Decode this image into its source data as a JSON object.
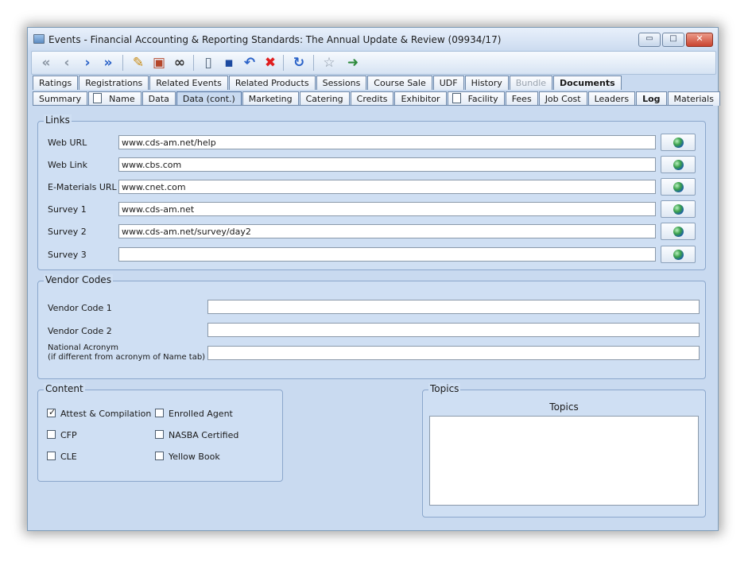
{
  "window": {
    "title": "Events - Financial Accounting & Reporting Standards: The Annual Update & Review (09934/17)",
    "controls": {
      "minimize": "▭",
      "maximize": "□",
      "close": "✕"
    }
  },
  "toolbar": {
    "first": "«",
    "prev": "‹",
    "next": "›",
    "last": "»",
    "notes": "✎",
    "report": "▣",
    "find": "∞",
    "new": "▯",
    "save": "▪",
    "undo": "↶",
    "delete": "✖",
    "refresh": "↻",
    "favorite": "☆",
    "exit": "➜"
  },
  "tabs_row1": [
    {
      "label": "Ratings"
    },
    {
      "label": "Registrations"
    },
    {
      "label": "Related Events"
    },
    {
      "label": "Related Products"
    },
    {
      "label": "Sessions"
    },
    {
      "label": "Course Sale"
    },
    {
      "label": "UDF"
    },
    {
      "label": "History"
    },
    {
      "label": "Bundle"
    },
    {
      "label": "Documents"
    }
  ],
  "tabs_row2": [
    {
      "label": "Summary"
    },
    {
      "label": "Name"
    },
    {
      "label": "Data"
    },
    {
      "label": "Data (cont.)"
    },
    {
      "label": "Marketing"
    },
    {
      "label": "Catering"
    },
    {
      "label": "Credits"
    },
    {
      "label": "Exhibitor"
    },
    {
      "label": "Facility"
    },
    {
      "label": "Fees"
    },
    {
      "label": "Job Cost"
    },
    {
      "label": "Leaders"
    },
    {
      "label": "Log"
    },
    {
      "label": "Materials"
    }
  ],
  "links": {
    "title": "Links",
    "rows": [
      {
        "label": "Web URL",
        "value": "www.cds-am.net/help"
      },
      {
        "label": "Web Link",
        "value": "www.cbs.com"
      },
      {
        "label": "E-Materials URL",
        "value": "www.cnet.com"
      },
      {
        "label": "Survey 1",
        "value": "www.cds-am.net"
      },
      {
        "label": "Survey 2",
        "value": "www.cds-am.net/survey/day2"
      },
      {
        "label": "Survey 3",
        "value": ""
      }
    ]
  },
  "vendor": {
    "title": "Vendor Codes",
    "code1_label": "Vendor Code 1",
    "code1_value": "",
    "code2_label": "Vendor Code 2",
    "code2_value": "",
    "acronym_label_1": "National Acronym",
    "acronym_label_2": "(if different from acronym of Name tab)",
    "acronym_value": ""
  },
  "content": {
    "title": "Content",
    "checks": [
      {
        "label": "Attest & Compilation",
        "checked": true
      },
      {
        "label": "Enrolled Agent",
        "checked": false
      },
      {
        "label": "CFP",
        "checked": false
      },
      {
        "label": "NASBA Certified",
        "checked": false
      },
      {
        "label": "CLE",
        "checked": false
      },
      {
        "label": "Yellow Book",
        "checked": false
      }
    ],
    "check_mark": "✓"
  },
  "topics": {
    "title": "Topics",
    "list_header": "Topics"
  }
}
